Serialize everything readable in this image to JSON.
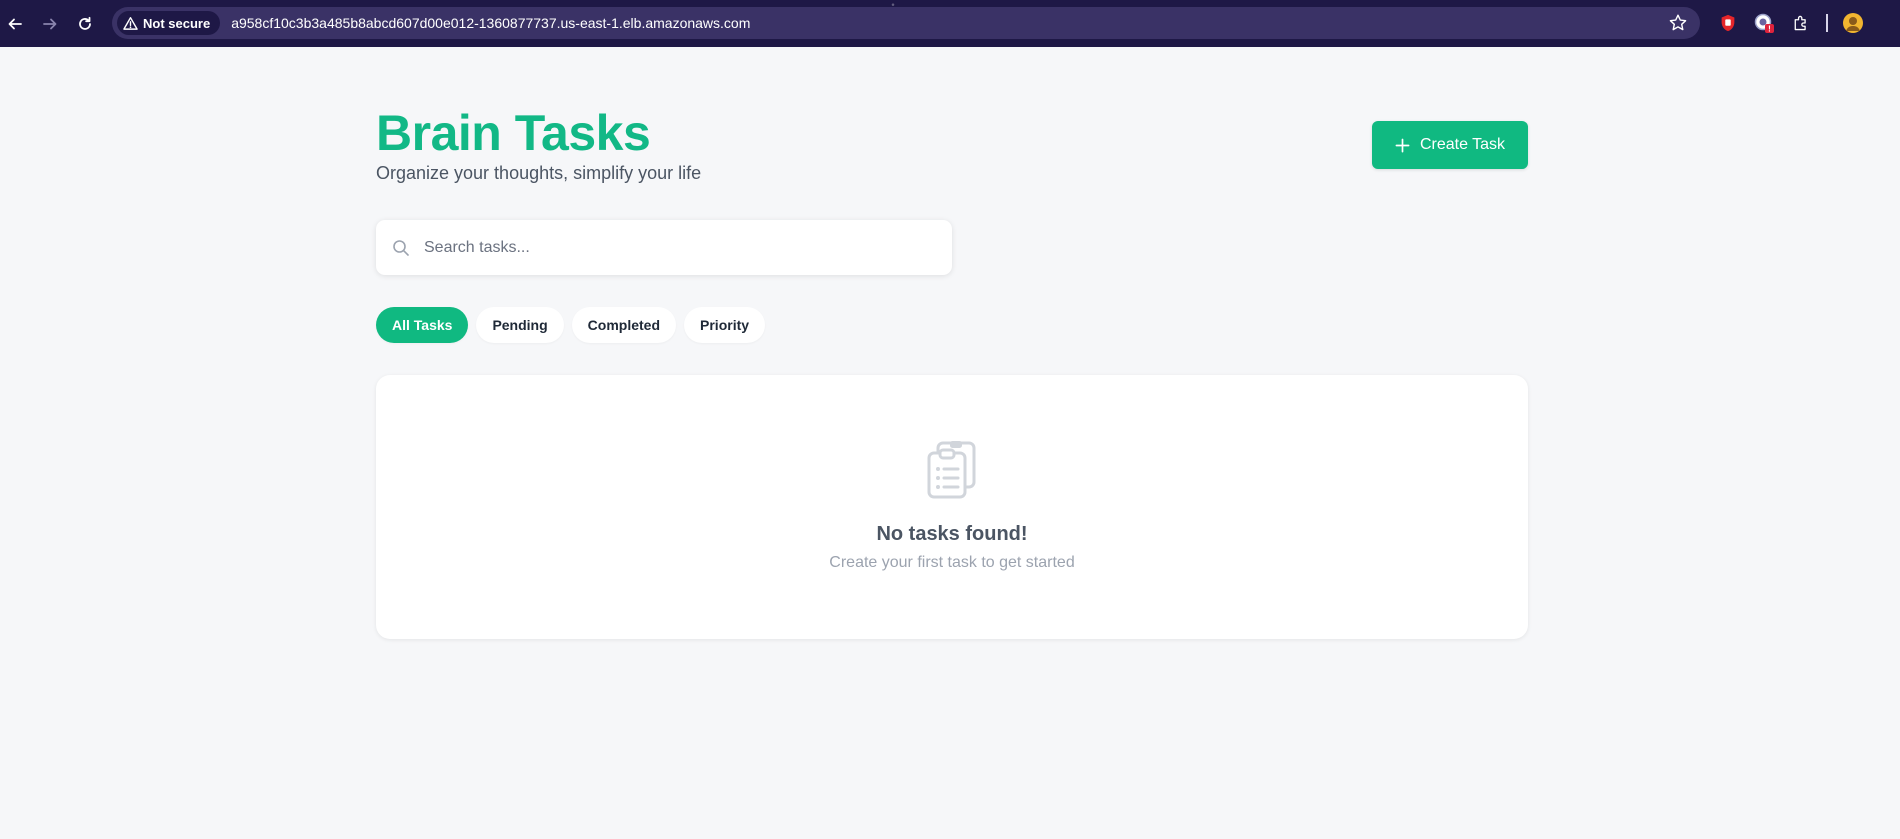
{
  "browser": {
    "security_label": "Not secure",
    "url": "a958cf10c3b3a485b8abcd607d00e012-1360877737.us-east-1.elb.amazonaws.com"
  },
  "header": {
    "title": "Brain Tasks",
    "subtitle": "Organize your thoughts, simplify your life",
    "create_label": "Create Task"
  },
  "search": {
    "placeholder": "Search tasks..."
  },
  "filters": [
    {
      "label": "All Tasks",
      "active": true
    },
    {
      "label": "Pending",
      "active": false
    },
    {
      "label": "Completed",
      "active": false
    },
    {
      "label": "Priority",
      "active": false
    }
  ],
  "empty_state": {
    "title": "No tasks found!",
    "message": "Create your first task to get started"
  },
  "colors": {
    "accent": "#10b981",
    "title": "#12b886",
    "chrome": "#1e1846"
  }
}
